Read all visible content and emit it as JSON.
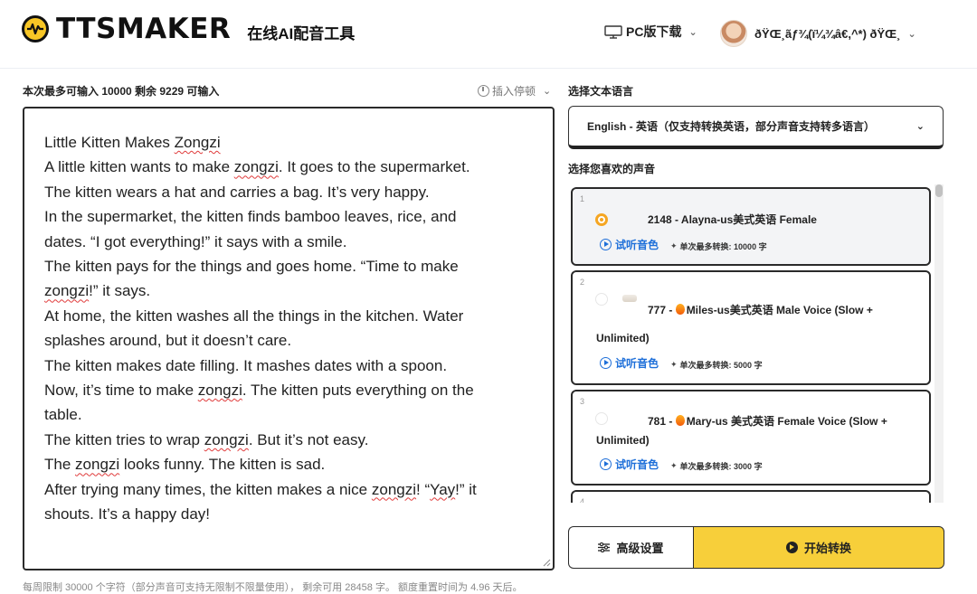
{
  "header": {
    "logo_text": "TTSMAKER",
    "logo_subtitle": "在线AI配音工具",
    "pc_download": "PC版下载",
    "username": "ðŸŒ¸ãƒ¾(ï¼¾â€,^*) ðŸŒ¸"
  },
  "editor": {
    "limit_label": "本次最多可输入 10000 剩余 9229 可输入",
    "insert_pause": "插入停顿",
    "lines": [
      [
        {
          "t": "Little Kitten Makes "
        },
        {
          "t": "Zongzi",
          "sq": true
        }
      ],
      [
        {
          "t": "A little kitten wants to make "
        },
        {
          "t": "zongzi",
          "sq": true
        },
        {
          "t": ". It goes to the supermarket."
        }
      ],
      [
        {
          "t": "The kitten wears a hat and carries a bag. It’s very happy."
        }
      ],
      [
        {
          "t": "In the supermarket, the kitten finds bamboo leaves, rice, and"
        }
      ],
      [
        {
          "t": "dates. “I got everything!” it says with a smile."
        }
      ],
      [
        {
          "t": "The kitten pays for the things and goes home. “Time to make"
        }
      ],
      [
        {
          "t": "zongzi",
          "sq": true
        },
        {
          "t": "!” it says."
        }
      ],
      [
        {
          "t": "At home, the kitten washes all the things in the kitchen. Water"
        }
      ],
      [
        {
          "t": "splashes around, but it doesn’t care."
        }
      ],
      [
        {
          "t": "The kitten makes date filling. It mashes dates with a spoon."
        }
      ],
      [
        {
          "t": "Now, it’s time to make "
        },
        {
          "t": "zongzi",
          "sq": true
        },
        {
          "t": ". The kitten puts everything on the"
        }
      ],
      [
        {
          "t": "table."
        }
      ],
      [
        {
          "t": "The kitten tries to wrap "
        },
        {
          "t": "zongzi",
          "sq": true
        },
        {
          "t": ". But it’s not easy."
        }
      ],
      [
        {
          "t": "The "
        },
        {
          "t": "zongzi",
          "sq": true
        },
        {
          "t": " looks funny. The kitten is sad."
        }
      ],
      [
        {
          "t": "After trying many times, the kitten makes a nice "
        },
        {
          "t": "zongzi",
          "sq": true
        },
        {
          "t": "! “"
        },
        {
          "t": "Yay",
          "sq": true
        },
        {
          "t": "!” it"
        }
      ],
      [
        {
          "t": "shouts. It’s a happy day!"
        }
      ]
    ]
  },
  "footer_note": "每周限制 30000 个字符（部分声音可支持无限制不限量使用）， 剩余可用 28458 字。 额度重置时间为 4.96 天后。",
  "language": {
    "label": "选择文本语言",
    "selected": "English - 英语（仅支持转换英语，部分声音支持转多语言）"
  },
  "voices": {
    "label": "选择您喜欢的声音",
    "items": [
      {
        "num": "1",
        "name": "2148 - Alayna-us美式英语 Female",
        "cont": "",
        "fire": false,
        "listen": "试听音色",
        "max": "单次最多转换: 10000 字",
        "selected": true
      },
      {
        "num": "2",
        "name": "777 - ",
        "name2": "Miles-us美式英语 Male Voice (Slow +",
        "cont": "Unlimited)",
        "fire": true,
        "listen": "试听音色",
        "max": "单次最多转换: 5000 字",
        "selected": false
      },
      {
        "num": "3",
        "name": "781 - ",
        "name2": "Mary-us 美式英语 Female Voice (Slow +",
        "cont": "Unlimited)",
        "fire": true,
        "listen": "试听音色",
        "max": "单次最多转换: 3000 字",
        "selected": false
      },
      {
        "num": "4"
      }
    ]
  },
  "buttons": {
    "advanced": "高级设置",
    "start": "开始转换"
  },
  "colors": {
    "accent_yellow": "#f7cf3a",
    "link_blue": "#1e6fd9",
    "radio_orange": "#f5a623"
  }
}
